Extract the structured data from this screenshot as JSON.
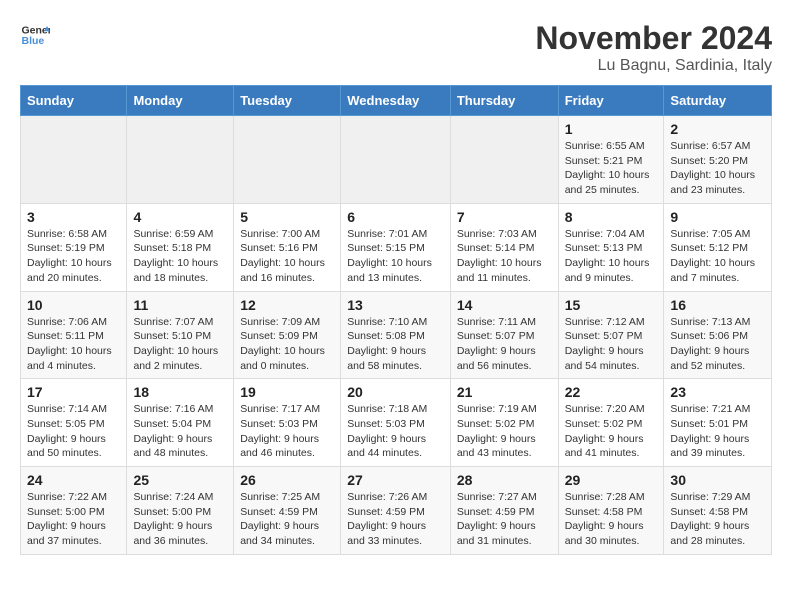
{
  "logo": {
    "line1": "General",
    "line2": "Blue"
  },
  "title": "November 2024",
  "location": "Lu Bagnu, Sardinia, Italy",
  "days_of_week": [
    "Sunday",
    "Monday",
    "Tuesday",
    "Wednesday",
    "Thursday",
    "Friday",
    "Saturday"
  ],
  "weeks": [
    [
      {
        "day": "",
        "info": ""
      },
      {
        "day": "",
        "info": ""
      },
      {
        "day": "",
        "info": ""
      },
      {
        "day": "",
        "info": ""
      },
      {
        "day": "",
        "info": ""
      },
      {
        "day": "1",
        "info": "Sunrise: 6:55 AM\nSunset: 5:21 PM\nDaylight: 10 hours and 25 minutes."
      },
      {
        "day": "2",
        "info": "Sunrise: 6:57 AM\nSunset: 5:20 PM\nDaylight: 10 hours and 23 minutes."
      }
    ],
    [
      {
        "day": "3",
        "info": "Sunrise: 6:58 AM\nSunset: 5:19 PM\nDaylight: 10 hours and 20 minutes."
      },
      {
        "day": "4",
        "info": "Sunrise: 6:59 AM\nSunset: 5:18 PM\nDaylight: 10 hours and 18 minutes."
      },
      {
        "day": "5",
        "info": "Sunrise: 7:00 AM\nSunset: 5:16 PM\nDaylight: 10 hours and 16 minutes."
      },
      {
        "day": "6",
        "info": "Sunrise: 7:01 AM\nSunset: 5:15 PM\nDaylight: 10 hours and 13 minutes."
      },
      {
        "day": "7",
        "info": "Sunrise: 7:03 AM\nSunset: 5:14 PM\nDaylight: 10 hours and 11 minutes."
      },
      {
        "day": "8",
        "info": "Sunrise: 7:04 AM\nSunset: 5:13 PM\nDaylight: 10 hours and 9 minutes."
      },
      {
        "day": "9",
        "info": "Sunrise: 7:05 AM\nSunset: 5:12 PM\nDaylight: 10 hours and 7 minutes."
      }
    ],
    [
      {
        "day": "10",
        "info": "Sunrise: 7:06 AM\nSunset: 5:11 PM\nDaylight: 10 hours and 4 minutes."
      },
      {
        "day": "11",
        "info": "Sunrise: 7:07 AM\nSunset: 5:10 PM\nDaylight: 10 hours and 2 minutes."
      },
      {
        "day": "12",
        "info": "Sunrise: 7:09 AM\nSunset: 5:09 PM\nDaylight: 10 hours and 0 minutes."
      },
      {
        "day": "13",
        "info": "Sunrise: 7:10 AM\nSunset: 5:08 PM\nDaylight: 9 hours and 58 minutes."
      },
      {
        "day": "14",
        "info": "Sunrise: 7:11 AM\nSunset: 5:07 PM\nDaylight: 9 hours and 56 minutes."
      },
      {
        "day": "15",
        "info": "Sunrise: 7:12 AM\nSunset: 5:07 PM\nDaylight: 9 hours and 54 minutes."
      },
      {
        "day": "16",
        "info": "Sunrise: 7:13 AM\nSunset: 5:06 PM\nDaylight: 9 hours and 52 minutes."
      }
    ],
    [
      {
        "day": "17",
        "info": "Sunrise: 7:14 AM\nSunset: 5:05 PM\nDaylight: 9 hours and 50 minutes."
      },
      {
        "day": "18",
        "info": "Sunrise: 7:16 AM\nSunset: 5:04 PM\nDaylight: 9 hours and 48 minutes."
      },
      {
        "day": "19",
        "info": "Sunrise: 7:17 AM\nSunset: 5:03 PM\nDaylight: 9 hours and 46 minutes."
      },
      {
        "day": "20",
        "info": "Sunrise: 7:18 AM\nSunset: 5:03 PM\nDaylight: 9 hours and 44 minutes."
      },
      {
        "day": "21",
        "info": "Sunrise: 7:19 AM\nSunset: 5:02 PM\nDaylight: 9 hours and 43 minutes."
      },
      {
        "day": "22",
        "info": "Sunrise: 7:20 AM\nSunset: 5:02 PM\nDaylight: 9 hours and 41 minutes."
      },
      {
        "day": "23",
        "info": "Sunrise: 7:21 AM\nSunset: 5:01 PM\nDaylight: 9 hours and 39 minutes."
      }
    ],
    [
      {
        "day": "24",
        "info": "Sunrise: 7:22 AM\nSunset: 5:00 PM\nDaylight: 9 hours and 37 minutes."
      },
      {
        "day": "25",
        "info": "Sunrise: 7:24 AM\nSunset: 5:00 PM\nDaylight: 9 hours and 36 minutes."
      },
      {
        "day": "26",
        "info": "Sunrise: 7:25 AM\nSunset: 4:59 PM\nDaylight: 9 hours and 34 minutes."
      },
      {
        "day": "27",
        "info": "Sunrise: 7:26 AM\nSunset: 4:59 PM\nDaylight: 9 hours and 33 minutes."
      },
      {
        "day": "28",
        "info": "Sunrise: 7:27 AM\nSunset: 4:59 PM\nDaylight: 9 hours and 31 minutes."
      },
      {
        "day": "29",
        "info": "Sunrise: 7:28 AM\nSunset: 4:58 PM\nDaylight: 9 hours and 30 minutes."
      },
      {
        "day": "30",
        "info": "Sunrise: 7:29 AM\nSunset: 4:58 PM\nDaylight: 9 hours and 28 minutes."
      }
    ]
  ]
}
